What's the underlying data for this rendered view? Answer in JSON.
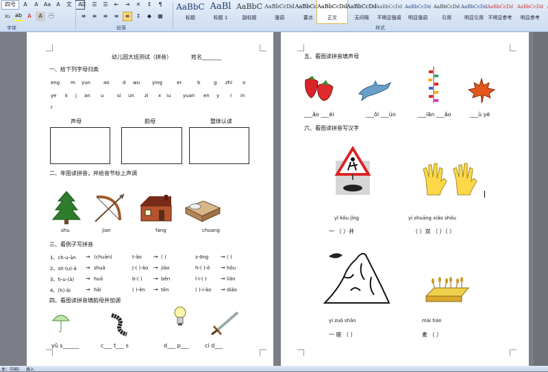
{
  "ribbon": {
    "font_size": "四号",
    "groups": {
      "font": "字体",
      "paragraph": "段落",
      "styles": "样式"
    },
    "styles": [
      {
        "sample": "AaBbC",
        "name": "标题"
      },
      {
        "sample": "AaBl",
        "name": "标题 1"
      },
      {
        "sample": "AaBbC",
        "name": "副标题"
      },
      {
        "sample": "AaBbCcDd",
        "name": "强调"
      },
      {
        "sample": "AaBbCcD",
        "name": "要点"
      },
      {
        "sample": "AaBbCcDd",
        "name": "正文"
      },
      {
        "sample": "AaBbCcDd",
        "name": "无间隔"
      },
      {
        "sample": "AaBbCcDd",
        "name": "不明显强调"
      },
      {
        "sample": "AaBbCcDd",
        "name": "明显强调"
      },
      {
        "sample": "AaBbCcDd",
        "name": "引用"
      },
      {
        "sample": "AaBbCcDd",
        "name": "明显引用"
      },
      {
        "sample": "AaBbCcDd",
        "name": "不明显参考"
      },
      {
        "sample": "AaBbCcDd",
        "name": "明显参考"
      },
      {
        "sample": "AaBbCcI",
        "name": "书"
      }
    ]
  },
  "page1": {
    "title": "幼儿园大班测试（拼音）",
    "name_label": "姓名_______",
    "s1_title": "一、给下列字母归类",
    "row1": [
      "eng",
      "m",
      "yun",
      "ao",
      "d",
      "wu",
      "ying",
      "er",
      "b",
      "g",
      "zhi",
      "o"
    ],
    "row2": [
      "ye",
      "k",
      "j",
      "an",
      "u",
      "si",
      "un",
      "zi",
      "x",
      "iu",
      "yuan",
      "en",
      "y",
      "I",
      "in"
    ],
    "row3": [
      "r"
    ],
    "box_labels": [
      "声母",
      "韵母",
      "整体认读"
    ],
    "s2_title": "二、年图读拼音，并给音节标上声调",
    "s2_words": [
      "shu",
      "jian",
      "fang",
      "chuang"
    ],
    "s3_title": "三、看例子写拼音",
    "s3_lines": [
      [
        "1、ch-u-ān",
        "(chuān)",
        "t-ǎo",
        "(    )",
        "z-ōng",
        "(    )"
      ],
      [
        "2、sh-(u)-ā",
        "shuā",
        "j-(  )-ǎo",
        "jiǎo",
        "h-(  )-ǒ",
        "hǒu"
      ],
      [
        "3、h-u-(ā)",
        "huā",
        "b-(  )",
        "běn",
        "l-i-(  )",
        "liǎn"
      ],
      [
        "4、(h)-ǎi",
        "hǎi",
        "(  )-ěn",
        "tēn",
        "(  )-i-ǎo",
        "diǎo"
      ]
    ],
    "s4_title": "四、看图读拼音填韵母并加调",
    "s4_fills": [
      "yǔ  s______",
      "c___  t___  s",
      "d___  p___",
      "ci  d___"
    ]
  },
  "page2": {
    "s5_title": "五、看图读拼音填声母",
    "s5_fills": [
      "___ǎo  ___éi",
      "___ǒi  ___ún",
      "___iān  ___ǎo",
      "___ù  yè"
    ],
    "s6_title": "六、看图读拼音写汉字",
    "s6_py1": "yǐ  kǒu  jǐng",
    "s6_hz1": "一  （    ）井",
    "s6_py2": "yì shuāng  xiǎo      shǒu",
    "s6_hz2": "（    ）双  （    ）（    ）",
    "s6_py3": "yí  zuǒ  shān",
    "s6_hz3": "一  座      （    ）",
    "s6_py4": "mài      tián",
    "s6_hz4": "麦      （    ）"
  },
  "statusbar": {
    "lang": "本：中国)",
    "mode": "插入"
  }
}
